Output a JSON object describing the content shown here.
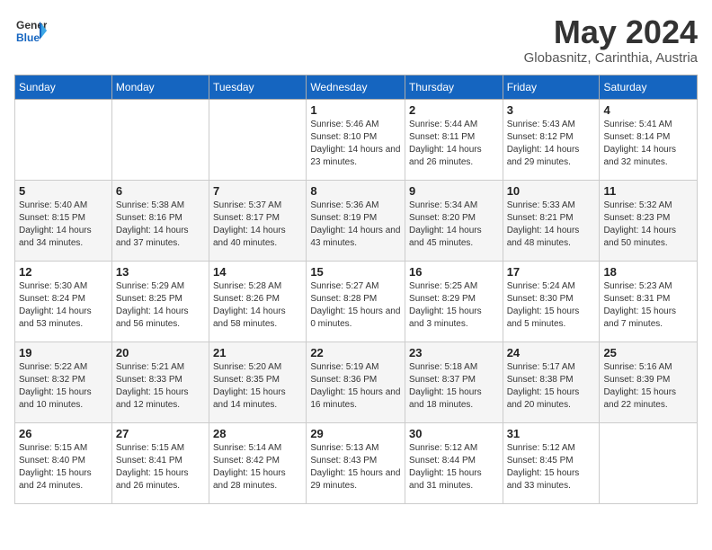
{
  "logo": {
    "general": "General",
    "blue": "Blue"
  },
  "title": "May 2024",
  "subtitle": "Globasnitz, Carinthia, Austria",
  "days_of_week": [
    "Sunday",
    "Monday",
    "Tuesday",
    "Wednesday",
    "Thursday",
    "Friday",
    "Saturday"
  ],
  "weeks": [
    [
      {
        "day": "",
        "sunrise": "",
        "sunset": "",
        "daylight": ""
      },
      {
        "day": "",
        "sunrise": "",
        "sunset": "",
        "daylight": ""
      },
      {
        "day": "",
        "sunrise": "",
        "sunset": "",
        "daylight": ""
      },
      {
        "day": "1",
        "sunrise": "Sunrise: 5:46 AM",
        "sunset": "Sunset: 8:10 PM",
        "daylight": "Daylight: 14 hours and 23 minutes."
      },
      {
        "day": "2",
        "sunrise": "Sunrise: 5:44 AM",
        "sunset": "Sunset: 8:11 PM",
        "daylight": "Daylight: 14 hours and 26 minutes."
      },
      {
        "day": "3",
        "sunrise": "Sunrise: 5:43 AM",
        "sunset": "Sunset: 8:12 PM",
        "daylight": "Daylight: 14 hours and 29 minutes."
      },
      {
        "day": "4",
        "sunrise": "Sunrise: 5:41 AM",
        "sunset": "Sunset: 8:14 PM",
        "daylight": "Daylight: 14 hours and 32 minutes."
      }
    ],
    [
      {
        "day": "5",
        "sunrise": "Sunrise: 5:40 AM",
        "sunset": "Sunset: 8:15 PM",
        "daylight": "Daylight: 14 hours and 34 minutes."
      },
      {
        "day": "6",
        "sunrise": "Sunrise: 5:38 AM",
        "sunset": "Sunset: 8:16 PM",
        "daylight": "Daylight: 14 hours and 37 minutes."
      },
      {
        "day": "7",
        "sunrise": "Sunrise: 5:37 AM",
        "sunset": "Sunset: 8:17 PM",
        "daylight": "Daylight: 14 hours and 40 minutes."
      },
      {
        "day": "8",
        "sunrise": "Sunrise: 5:36 AM",
        "sunset": "Sunset: 8:19 PM",
        "daylight": "Daylight: 14 hours and 43 minutes."
      },
      {
        "day": "9",
        "sunrise": "Sunrise: 5:34 AM",
        "sunset": "Sunset: 8:20 PM",
        "daylight": "Daylight: 14 hours and 45 minutes."
      },
      {
        "day": "10",
        "sunrise": "Sunrise: 5:33 AM",
        "sunset": "Sunset: 8:21 PM",
        "daylight": "Daylight: 14 hours and 48 minutes."
      },
      {
        "day": "11",
        "sunrise": "Sunrise: 5:32 AM",
        "sunset": "Sunset: 8:23 PM",
        "daylight": "Daylight: 14 hours and 50 minutes."
      }
    ],
    [
      {
        "day": "12",
        "sunrise": "Sunrise: 5:30 AM",
        "sunset": "Sunset: 8:24 PM",
        "daylight": "Daylight: 14 hours and 53 minutes."
      },
      {
        "day": "13",
        "sunrise": "Sunrise: 5:29 AM",
        "sunset": "Sunset: 8:25 PM",
        "daylight": "Daylight: 14 hours and 56 minutes."
      },
      {
        "day": "14",
        "sunrise": "Sunrise: 5:28 AM",
        "sunset": "Sunset: 8:26 PM",
        "daylight": "Daylight: 14 hours and 58 minutes."
      },
      {
        "day": "15",
        "sunrise": "Sunrise: 5:27 AM",
        "sunset": "Sunset: 8:28 PM",
        "daylight": "Daylight: 15 hours and 0 minutes."
      },
      {
        "day": "16",
        "sunrise": "Sunrise: 5:25 AM",
        "sunset": "Sunset: 8:29 PM",
        "daylight": "Daylight: 15 hours and 3 minutes."
      },
      {
        "day": "17",
        "sunrise": "Sunrise: 5:24 AM",
        "sunset": "Sunset: 8:30 PM",
        "daylight": "Daylight: 15 hours and 5 minutes."
      },
      {
        "day": "18",
        "sunrise": "Sunrise: 5:23 AM",
        "sunset": "Sunset: 8:31 PM",
        "daylight": "Daylight: 15 hours and 7 minutes."
      }
    ],
    [
      {
        "day": "19",
        "sunrise": "Sunrise: 5:22 AM",
        "sunset": "Sunset: 8:32 PM",
        "daylight": "Daylight: 15 hours and 10 minutes."
      },
      {
        "day": "20",
        "sunrise": "Sunrise: 5:21 AM",
        "sunset": "Sunset: 8:33 PM",
        "daylight": "Daylight: 15 hours and 12 minutes."
      },
      {
        "day": "21",
        "sunrise": "Sunrise: 5:20 AM",
        "sunset": "Sunset: 8:35 PM",
        "daylight": "Daylight: 15 hours and 14 minutes."
      },
      {
        "day": "22",
        "sunrise": "Sunrise: 5:19 AM",
        "sunset": "Sunset: 8:36 PM",
        "daylight": "Daylight: 15 hours and 16 minutes."
      },
      {
        "day": "23",
        "sunrise": "Sunrise: 5:18 AM",
        "sunset": "Sunset: 8:37 PM",
        "daylight": "Daylight: 15 hours and 18 minutes."
      },
      {
        "day": "24",
        "sunrise": "Sunrise: 5:17 AM",
        "sunset": "Sunset: 8:38 PM",
        "daylight": "Daylight: 15 hours and 20 minutes."
      },
      {
        "day": "25",
        "sunrise": "Sunrise: 5:16 AM",
        "sunset": "Sunset: 8:39 PM",
        "daylight": "Daylight: 15 hours and 22 minutes."
      }
    ],
    [
      {
        "day": "26",
        "sunrise": "Sunrise: 5:15 AM",
        "sunset": "Sunset: 8:40 PM",
        "daylight": "Daylight: 15 hours and 24 minutes."
      },
      {
        "day": "27",
        "sunrise": "Sunrise: 5:15 AM",
        "sunset": "Sunset: 8:41 PM",
        "daylight": "Daylight: 15 hours and 26 minutes."
      },
      {
        "day": "28",
        "sunrise": "Sunrise: 5:14 AM",
        "sunset": "Sunset: 8:42 PM",
        "daylight": "Daylight: 15 hours and 28 minutes."
      },
      {
        "day": "29",
        "sunrise": "Sunrise: 5:13 AM",
        "sunset": "Sunset: 8:43 PM",
        "daylight": "Daylight: 15 hours and 29 minutes."
      },
      {
        "day": "30",
        "sunrise": "Sunrise: 5:12 AM",
        "sunset": "Sunset: 8:44 PM",
        "daylight": "Daylight: 15 hours and 31 minutes."
      },
      {
        "day": "31",
        "sunrise": "Sunrise: 5:12 AM",
        "sunset": "Sunset: 8:45 PM",
        "daylight": "Daylight: 15 hours and 33 minutes."
      },
      {
        "day": "",
        "sunrise": "",
        "sunset": "",
        "daylight": ""
      }
    ]
  ]
}
